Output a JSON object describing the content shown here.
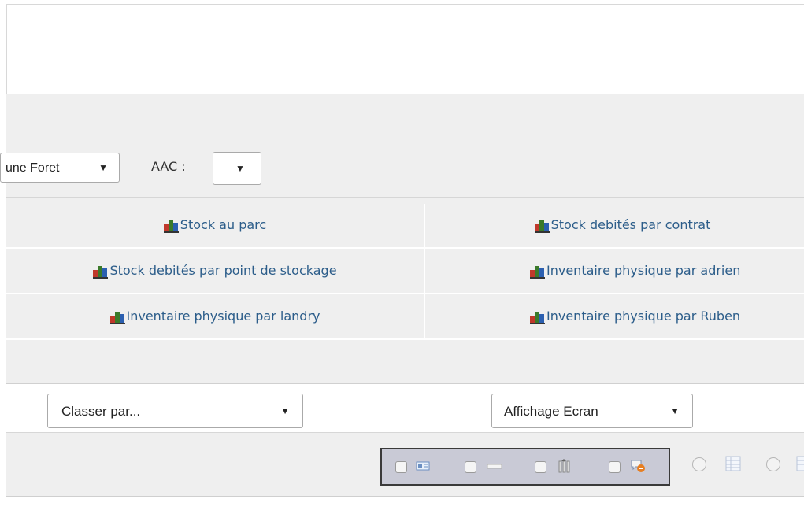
{
  "filters": {
    "foret_value": "une Foret",
    "aac_label": "AAC :",
    "aac_value": ""
  },
  "reports": [
    {
      "label": "Stock au parc"
    },
    {
      "label": "Stock debités par contrat"
    },
    {
      "label": "Stock debités par point de stockage"
    },
    {
      "label": "Inventaire physique par adrien"
    },
    {
      "label": "Inventaire physique par landry"
    },
    {
      "label": "Inventaire physique par Ruben"
    }
  ],
  "sort": {
    "classer_value": "Classer par...",
    "affichage_value": "Affichage Ecran"
  },
  "toolbar": {
    "icons": [
      "id-card-icon",
      "bar-icon",
      "columns-icon",
      "chat-stop-icon"
    ],
    "radio_icons": [
      "table-icon",
      "table-icon"
    ]
  },
  "colors": {
    "link": "#2c5d8a",
    "panel": "#efefef",
    "toolbar_bg": "#c9cad6"
  }
}
